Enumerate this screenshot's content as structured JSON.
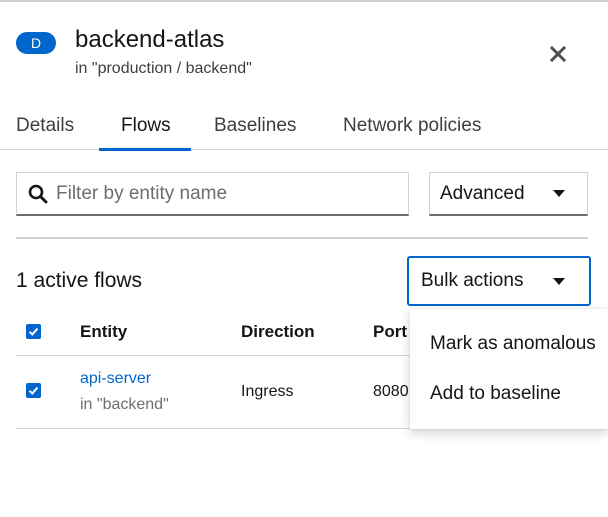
{
  "header": {
    "badge": "D",
    "title": "backend-atlas",
    "subtitle": "in \"production / backend\""
  },
  "tabs": [
    {
      "label": "Details",
      "active": false
    },
    {
      "label": "Flows",
      "active": true
    },
    {
      "label": "Baselines",
      "active": false
    },
    {
      "label": "Network policies",
      "active": false
    }
  ],
  "toolbar": {
    "search_placeholder": "Filter by entity name",
    "search_value": "",
    "advanced_label": "Advanced"
  },
  "flows": {
    "count_label": "1 active flows",
    "bulk_actions_label": "Bulk actions",
    "bulk_menu": [
      "Mark as anomalous",
      "Add to baseline"
    ]
  },
  "table": {
    "columns": [
      "Entity",
      "Direction",
      "Port"
    ],
    "rows": [
      {
        "entity": "api-server",
        "namespace": "in \"backend\"",
        "direction": "Ingress",
        "port": "8080",
        "checked": true
      }
    ],
    "header_checked": true
  },
  "colors": {
    "accent": "#0066cc",
    "border": "#d2d2d2",
    "muted_text": "#6a6e73"
  },
  "icons": {
    "close": "close-icon",
    "search": "search-icon",
    "caret": "caret-down-icon",
    "check": "check-icon"
  }
}
